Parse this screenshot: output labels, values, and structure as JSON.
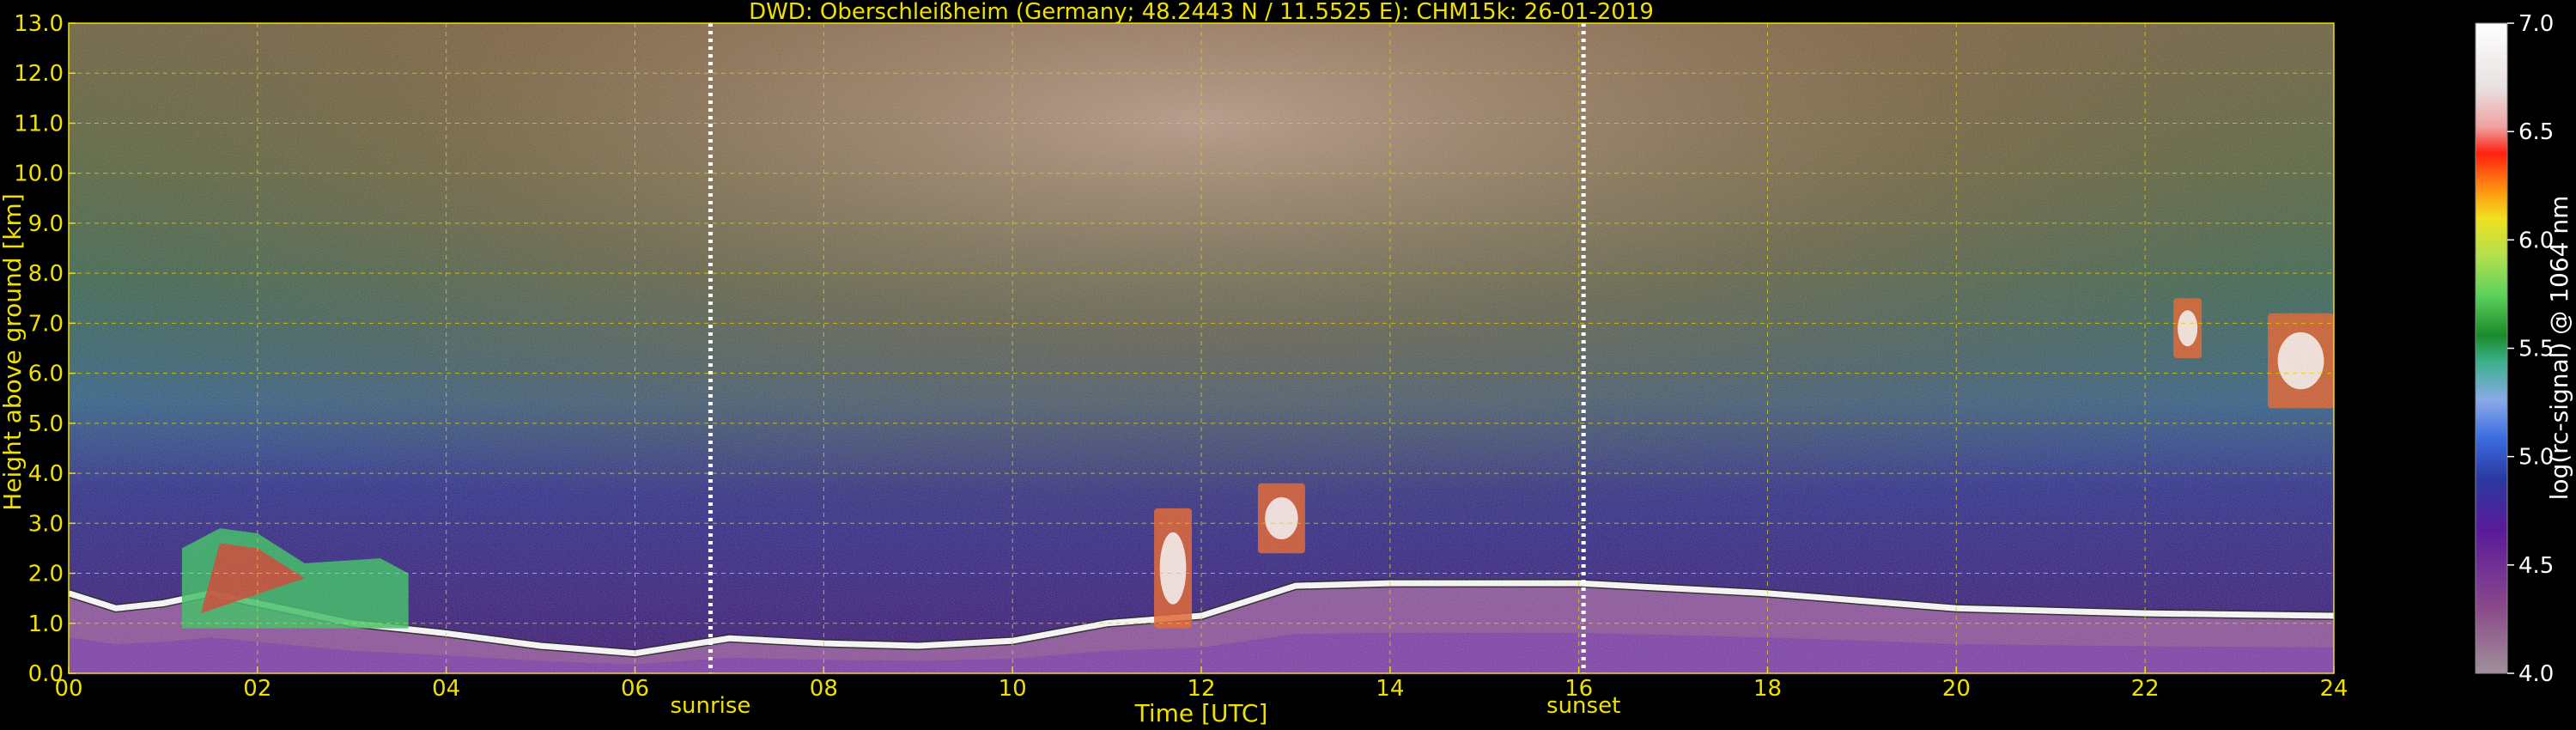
{
  "chart_data": {
    "type": "heatmap",
    "title": "DWD: Oberschleißheim (Germany; 48.2443 N / 11.5525 E):    CHM15k: 26-01-2019",
    "xlabel": "Time [UTC]",
    "ylabel": "Height above ground [km]",
    "xlim": [
      0,
      24
    ],
    "ylim": [
      0,
      13
    ],
    "xticks": [
      "00",
      "02",
      "04",
      "06",
      "08",
      "10",
      "12",
      "14",
      "16",
      "18",
      "20",
      "22",
      "24"
    ],
    "xtick_values": [
      0,
      2,
      4,
      6,
      8,
      10,
      12,
      14,
      16,
      18,
      20,
      22,
      24
    ],
    "yticks": [
      "0.0",
      "1.0",
      "2.0",
      "3.0",
      "4.0",
      "5.0",
      "6.0",
      "7.0",
      "8.0",
      "9.0",
      "10.0",
      "11.0",
      "12.0",
      "13.0"
    ],
    "ytick_values": [
      0,
      1,
      2,
      3,
      4,
      5,
      6,
      7,
      8,
      9,
      10,
      11,
      12,
      13
    ],
    "grid": true,
    "annotations": [
      {
        "text": "sunrise",
        "x": 6.8
      },
      {
        "text": "sunset",
        "x": 16.05
      }
    ],
    "vertical_lines": [
      6.8,
      16.05
    ],
    "colorbar": {
      "label": "log(rc-signal) @ 1064 nm",
      "range": [
        4.0,
        7.0
      ],
      "ticks": [
        "4.0",
        "4.5",
        "5.0",
        "5.5",
        "6.0",
        "6.5",
        "7.0"
      ],
      "tick_values": [
        4.0,
        4.5,
        5.0,
        5.5,
        6.0,
        6.5,
        7.0
      ]
    },
    "features": [
      {
        "name": "boundary layer top",
        "points": [
          [
            0,
            1.6
          ],
          [
            0.5,
            1.3
          ],
          [
            1,
            1.4
          ],
          [
            1.5,
            1.6
          ],
          [
            2,
            1.4
          ],
          [
            3,
            1.0
          ],
          [
            4,
            0.8
          ],
          [
            5,
            0.55
          ],
          [
            6,
            0.4
          ],
          [
            7,
            0.7
          ],
          [
            8,
            0.6
          ],
          [
            9,
            0.55
          ],
          [
            10,
            0.65
          ],
          [
            11,
            1.0
          ],
          [
            12,
            1.15
          ],
          [
            13,
            1.75
          ],
          [
            14,
            1.8
          ],
          [
            16,
            1.8
          ],
          [
            18,
            1.6
          ],
          [
            20,
            1.3
          ],
          [
            22,
            1.2
          ],
          [
            24,
            1.15
          ]
        ]
      },
      {
        "name": "aerosol plume",
        "points": [
          [
            1.2,
            2.5
          ],
          [
            1.6,
            2.9
          ],
          [
            2.0,
            2.8
          ],
          [
            2.5,
            2.2
          ],
          [
            3.3,
            2.3
          ],
          [
            3.6,
            2.0
          ]
        ]
      },
      {
        "name": "cloud",
        "x": [
          12.6,
          13.1
        ],
        "y": [
          2.4,
          3.8
        ]
      },
      {
        "name": "cloud",
        "x": [
          11.5,
          11.9
        ],
        "y": [
          0.9,
          3.3
        ]
      },
      {
        "name": "cloud",
        "x": [
          22.3,
          22.6
        ],
        "y": [
          6.3,
          7.5
        ]
      },
      {
        "name": "cloud",
        "x": [
          23.3,
          24.0
        ],
        "y": [
          5.3,
          7.2
        ]
      }
    ]
  }
}
